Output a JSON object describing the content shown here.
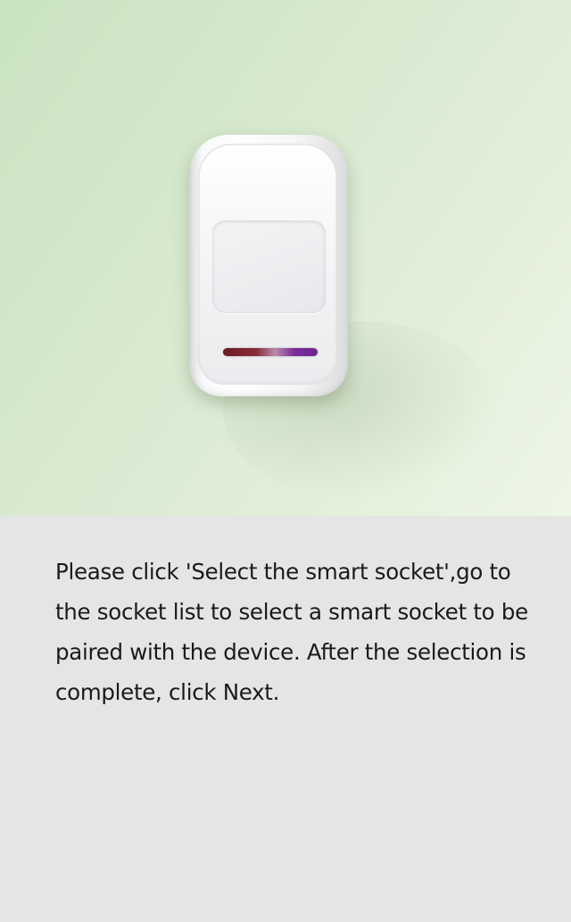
{
  "hero": {
    "device_icon": "motion-sensor-icon"
  },
  "instruction": {
    "text": "Please click 'Select the smart socket',go to the socket list to select a smart socket to be paired with the device. After the selection is complete, click Next."
  },
  "colors": {
    "hero_background": "#d5e8cd",
    "content_background": "#e5e5e5",
    "text": "#1a1a1a"
  }
}
